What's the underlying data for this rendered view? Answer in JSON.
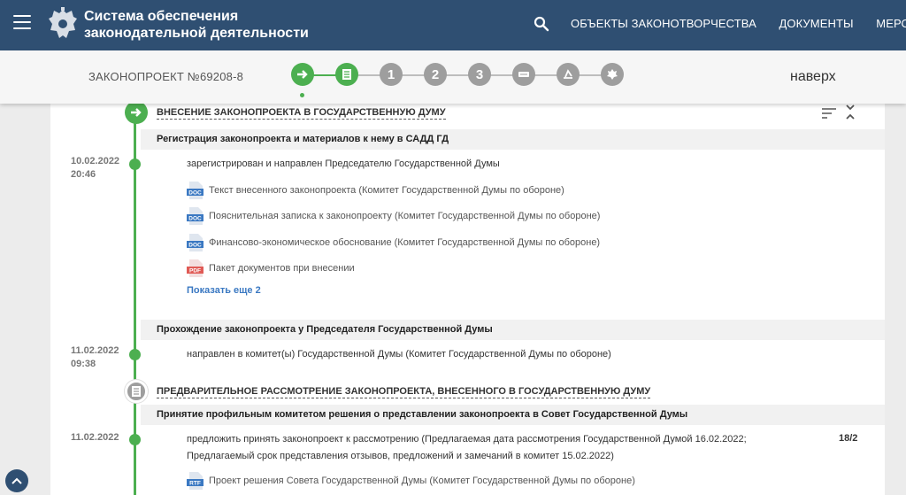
{
  "header": {
    "title_line1": "Система обеспечения",
    "title_line2": "законодательной деятельности",
    "nav": [
      "ОБЪЕКТЫ ЗАКОНОТВОРЧЕСТВА",
      "ДОКУМЕНТЫ",
      "МЕРОПРИЯТ"
    ],
    "brand_color": "#2f4f72"
  },
  "stagebar": {
    "bill_number": "ЗАКОНОПРОЕКТ №69208-8",
    "to_top": "наверх",
    "stages": [
      {
        "icon": "arrow-right-icon",
        "state": "done"
      },
      {
        "icon": "document-list-icon",
        "state": "done"
      },
      {
        "label": "1",
        "state": "pending"
      },
      {
        "label": "2",
        "state": "pending"
      },
      {
        "label": "3",
        "state": "pending"
      },
      {
        "icon": "council-icon",
        "state": "pending"
      },
      {
        "icon": "signature-icon",
        "state": "pending"
      },
      {
        "icon": "emblem-icon",
        "state": "pending"
      }
    ],
    "accent_color": "#4caf50"
  },
  "timeline": {
    "stage1_title": "ВНЕСЕНИЕ ЗАКОНОПРОЕКТА В ГОСУДАРСТВЕННУЮ ДУМУ",
    "sub1_title": "Регистрация законопроекта и материалов к нему в САДД ГД",
    "event1": {
      "date": "10.02.2022",
      "time": "20:46",
      "text": "зарегистрирован и направлен Председателю Государственной Думы",
      "docs": [
        {
          "type": "DOC",
          "label": "Текст внесенного законопроекта (Комитет Государственной Думы по обороне)"
        },
        {
          "type": "DOC",
          "label": "Пояснительная записка к законопроекту (Комитет Государственной Думы по обороне)"
        },
        {
          "type": "DOC",
          "label": "Финансово-экономическое обоснование (Комитет Государственной Думы по обороне)"
        },
        {
          "type": "PDF",
          "label": "Пакет документов при внесении"
        }
      ],
      "show_more": "Показать еще 2"
    },
    "sub2_title": "Прохождение законопроекта у Председателя Государственной Думы",
    "event2": {
      "date": "11.02.2022",
      "time": "09:38",
      "text": "направлен в комитет(ы) Государственной Думы (Комитет Государственной Думы по обороне)"
    },
    "stage2_title": "ПРЕДВАРИТЕЛЬНОЕ РАССМОТРЕНИЕ ЗАКОНОПРОЕКТА, ВНЕСЕННОГО В ГОСУДАРСТВЕННУЮ ДУМУ",
    "sub3_title": "Принятие профильным комитетом решения о представлении законопроекта в Совет Государственной Думы",
    "event3": {
      "date": "11.02.2022",
      "text_line1": "предложить принять законопроект к рассмотрению (Предлагаемая дата рассмотрения Государственной Думой 16.02.2022;",
      "text_line2": "Предлагаемый срок представления отзывов, предложений и замечаний в комитет 15.02.2022)",
      "count": "18/2",
      "docs": [
        {
          "type": "RTF",
          "label": "Проект решения Совета Государственной Думы (Комитет Государственной Думы по обороне)"
        }
      ]
    }
  }
}
